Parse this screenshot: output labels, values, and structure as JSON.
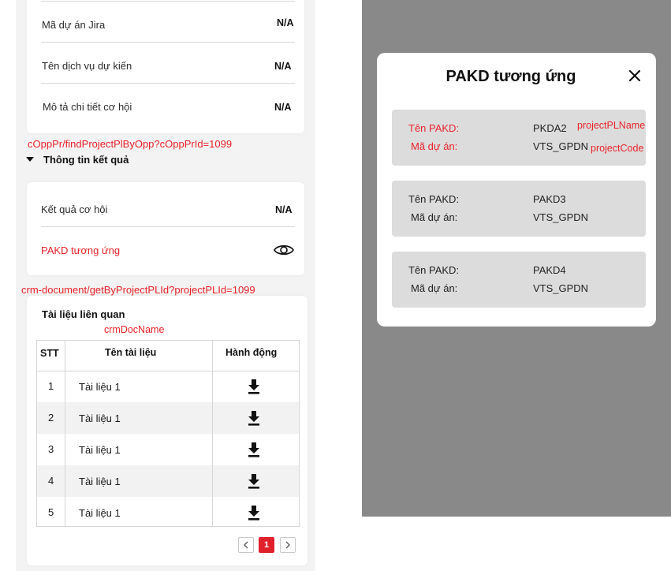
{
  "info_rows": [
    {
      "label": "Mã dự án Jira",
      "value": "N/A"
    },
    {
      "label": "Tên dịch vụ dự kiến",
      "value": "N/A"
    },
    {
      "label": "Mô tả chi tiết cơ hội",
      "value": "N/A"
    }
  ],
  "annotations": {
    "find_project_api": "cOppPr/findProjectPlByOpp?cOppPrId=1099",
    "document_api": "crm-document/getByProjectPLId?projectPLId=1099",
    "doc_name_field": "crmDocName",
    "project_pl_name_field": "projectPLName",
    "project_code_field": "projectCode"
  },
  "result_section": {
    "title": "Thông tin kết quả",
    "outcome_label": "Kết quả cơ hội",
    "outcome_value": "N/A",
    "pakd_link_label": "PAKD tương ứng",
    "pakd_icon": "eye-icon"
  },
  "documents": {
    "title": "Tài liệu liên quan",
    "columns": [
      "STT",
      "Tên tài liệu",
      "Hành động"
    ],
    "rows": [
      {
        "stt": "1",
        "name": "Tài liệu 1",
        "action_icon": "download-icon"
      },
      {
        "stt": "2",
        "name": "Tài liệu 1",
        "action_icon": "download-icon"
      },
      {
        "stt": "3",
        "name": "Tài liệu 1",
        "action_icon": "download-icon"
      },
      {
        "stt": "4",
        "name": "Tài liệu 1",
        "action_icon": "download-icon"
      },
      {
        "stt": "5",
        "name": "Tài liệu 1",
        "action_icon": "download-icon"
      }
    ],
    "pagination": {
      "current_page": "1",
      "prev_icon": "chevron-left-icon",
      "next_icon": "chevron-right-icon"
    }
  },
  "modal": {
    "title": "PAKD tương ứng",
    "close_icon": "close-icon",
    "items": [
      {
        "name_label": "Tên PAKD:",
        "name_value": "PKDA2",
        "code_label": "Mã dự án:",
        "code_value": "VTS_GPDN"
      },
      {
        "name_label": "Tên PAKD:",
        "name_value": "PAKD3",
        "code_label": "Mã dự án:",
        "code_value": "VTS_GPDN"
      },
      {
        "name_label": "Tên PAKD:",
        "name_value": "PAKD4",
        "code_label": "Mã dự án:",
        "code_value": "VTS_GPDN"
      }
    ]
  },
  "colors": {
    "accent_red": "#e8232a",
    "overlay_gray": "#898989",
    "card_gray": "#dcdcdc"
  }
}
